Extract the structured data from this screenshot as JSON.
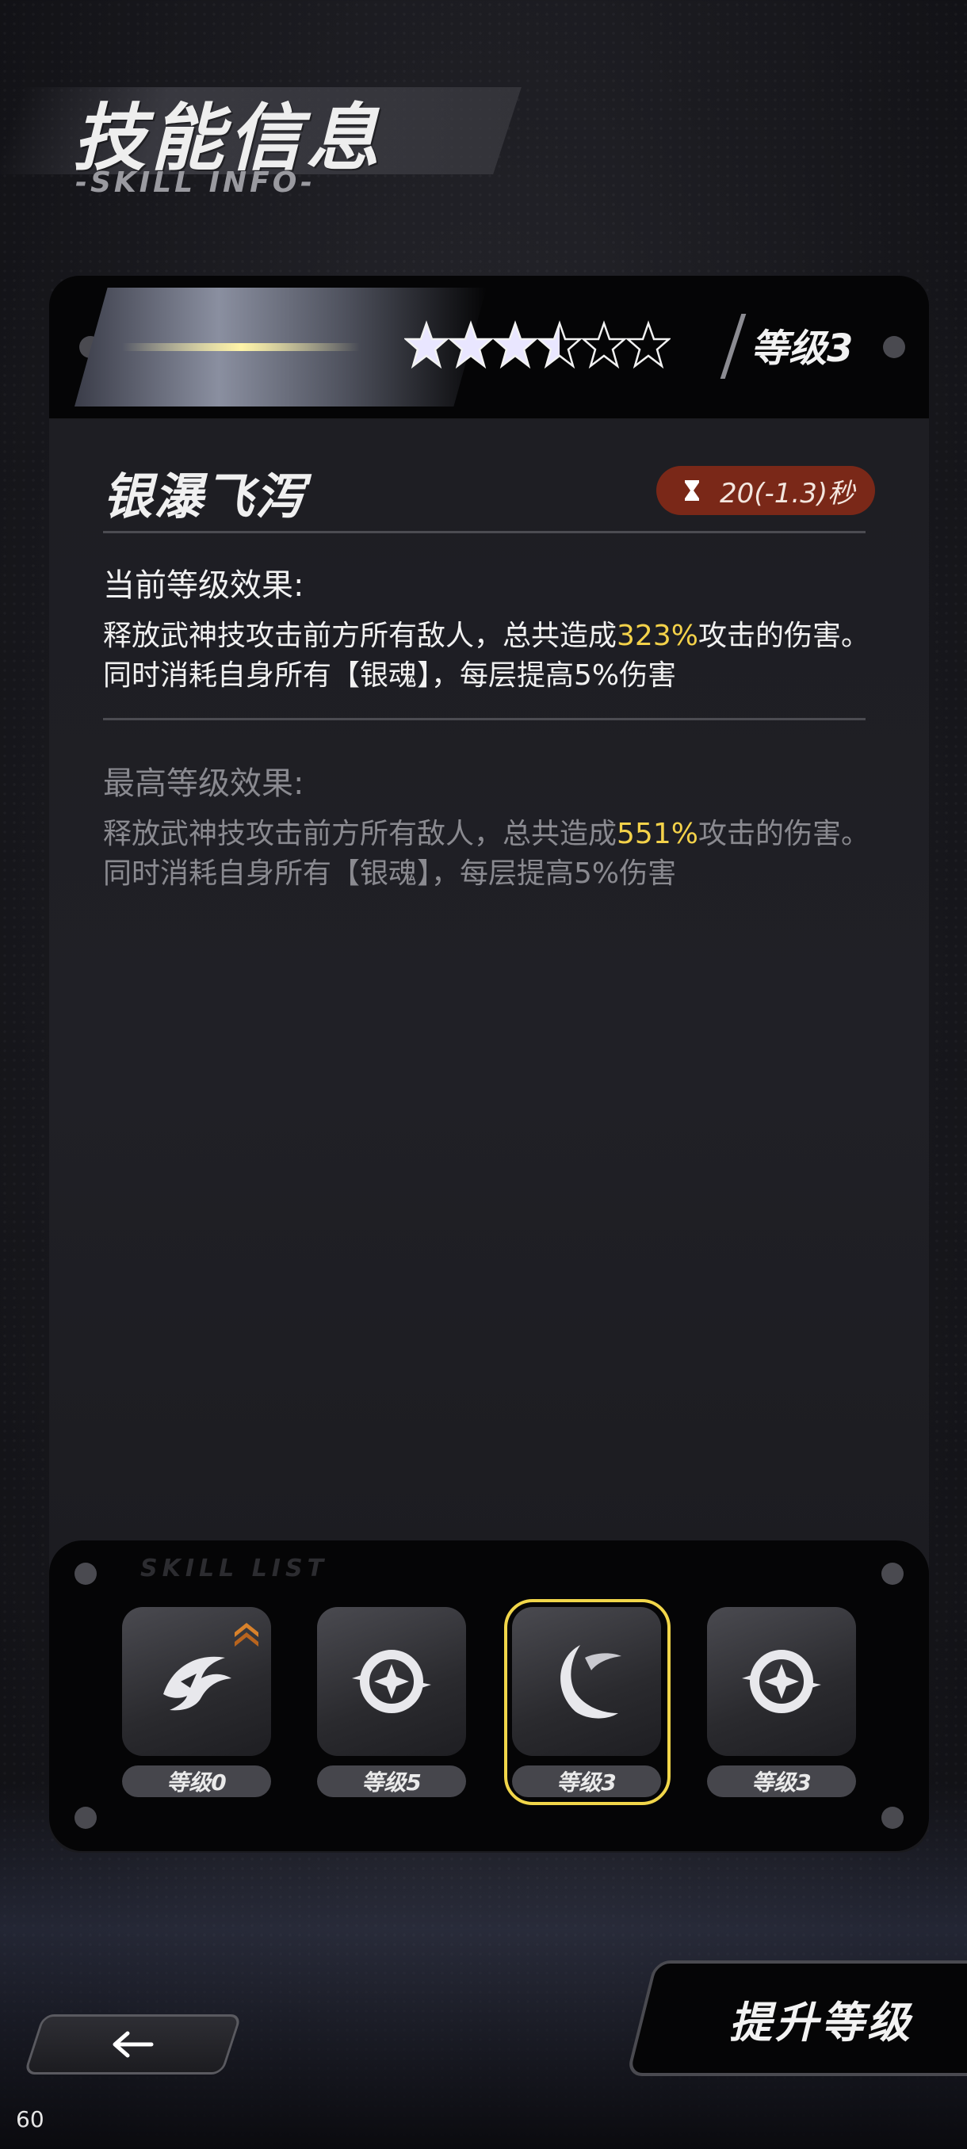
{
  "header": {
    "title": "技能信息",
    "subtitle": "-SKILL INFO-"
  },
  "card": {
    "stars_total": 6,
    "stars_filled": 3.5,
    "level_label": "等级3",
    "skill_name": "银瀑飞泻",
    "cooldown": "20(-1.3)秒",
    "current": {
      "label": "当前等级效果:",
      "text_before": "释放武神技攻击前方所有敌人，总共造成",
      "highlight": "323%",
      "text_after": "攻击的伤害。同时消耗自身所有【银魂】，每层提高5%伤害"
    },
    "max": {
      "label": "最高等级效果:",
      "text_before": "释放武神技攻击前方所有敌人，总共造成",
      "highlight": "551%",
      "text_after": "攻击的伤害。同时消耗自身所有【银魂】，每层提高5%伤害"
    }
  },
  "skill_list": {
    "title": "SKILL LIST",
    "slots": [
      {
        "icon": "eagle-claw-icon",
        "level": "等级0",
        "upgradable": true,
        "selected": false
      },
      {
        "icon": "shuriken-icon",
        "level": "等级5",
        "upgradable": false,
        "selected": false
      },
      {
        "icon": "crescent-slash-icon",
        "level": "等级3",
        "upgradable": false,
        "selected": true
      },
      {
        "icon": "shuriken-icon",
        "level": "等级3",
        "upgradable": false,
        "selected": false
      }
    ]
  },
  "buttons": {
    "back_icon": "arrow-left-icon",
    "upgrade_label": "提升等级"
  },
  "fps": "60",
  "colors": {
    "highlight": "#f4d24a",
    "cooldown_bg": "#7a2818",
    "selected_border": "#f1d64a"
  }
}
